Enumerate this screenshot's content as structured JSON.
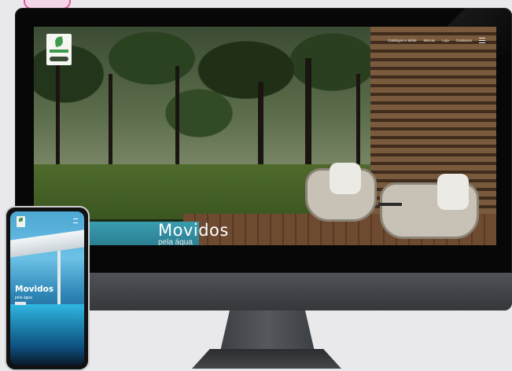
{
  "desktop": {
    "nav": {
      "items": [
        "Catálogos e Mídia",
        "Marcas",
        "Loja",
        "Contactos"
      ]
    },
    "hero": {
      "title": "Movidos",
      "subtitle": "pela água"
    }
  },
  "mobile": {
    "hero": {
      "title": "Movidos",
      "subtitle": "pela água"
    }
  }
}
